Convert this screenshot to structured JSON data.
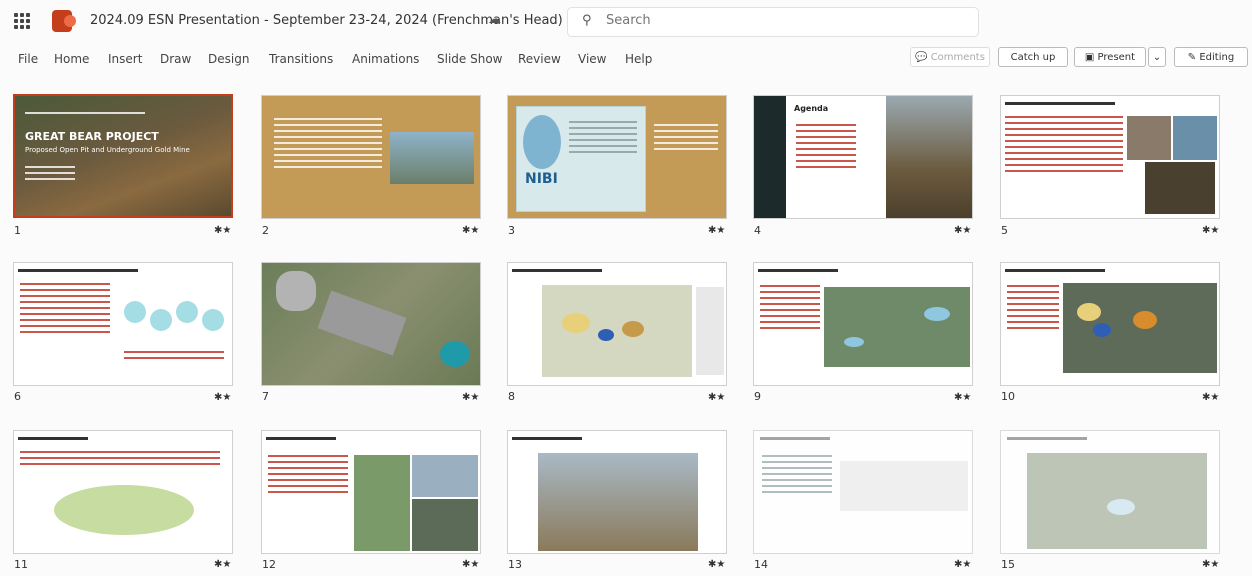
{
  "app": {
    "title": "2024.09 ESN Presentation - September 23-24, 2024 (Frenchman's Head)",
    "cloud_icon": "cloud-sync-icon",
    "search_placeholder": "Search",
    "search_icon": "search-icon",
    "waffle_icon": "app-launcher-icon",
    "app_icon": "powerpoint-icon"
  },
  "menu": [
    "File",
    "Home",
    "Insert",
    "Draw",
    "Design",
    "Transitions",
    "Animations",
    "Slide Show",
    "Review",
    "View",
    "Help"
  ],
  "toolbar": {
    "comments": "Comments",
    "catch_up": "Catch up",
    "present": "Present",
    "editing": "Editing",
    "dropdown_icon": "chevron-down-icon"
  },
  "slides": [
    {
      "num": "1",
      "title": "GREAT BEAR PROJECT",
      "subtitle": "Proposed Open Pit and Underground Gold Mine",
      "selected": true
    },
    {
      "num": "2"
    },
    {
      "num": "3",
      "title": "NIBI"
    },
    {
      "num": "4",
      "title": "Agenda"
    },
    {
      "num": "5"
    },
    {
      "num": "6"
    },
    {
      "num": "7"
    },
    {
      "num": "8"
    },
    {
      "num": "9"
    },
    {
      "num": "10"
    },
    {
      "num": "11"
    },
    {
      "num": "12"
    },
    {
      "num": "13"
    },
    {
      "num": "14"
    },
    {
      "num": "15"
    }
  ],
  "star_icon": "star-icon",
  "colors": {
    "accent": "#c43e1c",
    "tan": "#c39b57",
    "page": "#fbfbfb"
  }
}
